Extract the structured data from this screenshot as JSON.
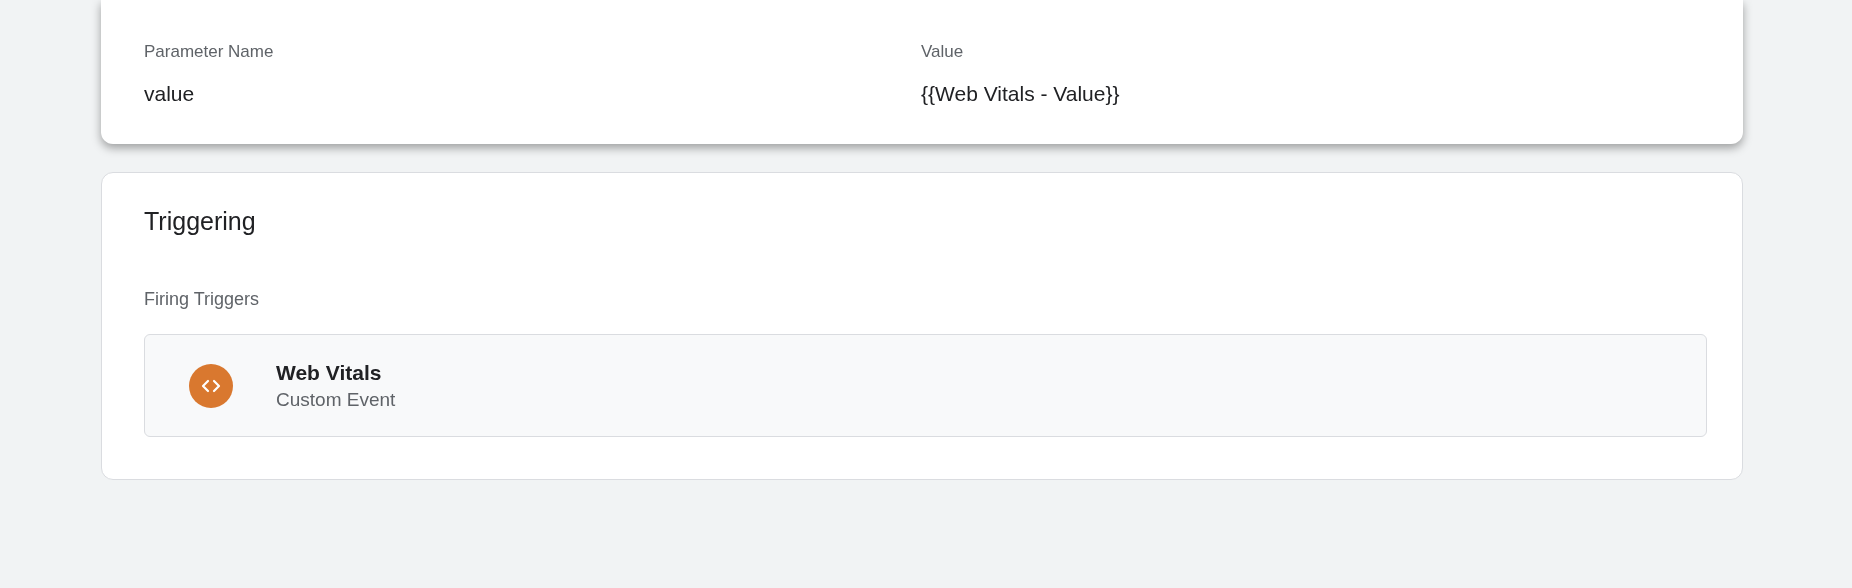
{
  "event_parameters": {
    "columns": [
      "Parameter Name",
      "Value"
    ],
    "rows": [
      {
        "name": "value",
        "value": "{{Web Vitals - Value}}"
      }
    ]
  },
  "triggering": {
    "title": "Triggering",
    "section_label": "Firing Triggers",
    "triggers": [
      {
        "name": "Web Vitals",
        "type": "Custom Event",
        "color": "#d9782f"
      }
    ]
  }
}
